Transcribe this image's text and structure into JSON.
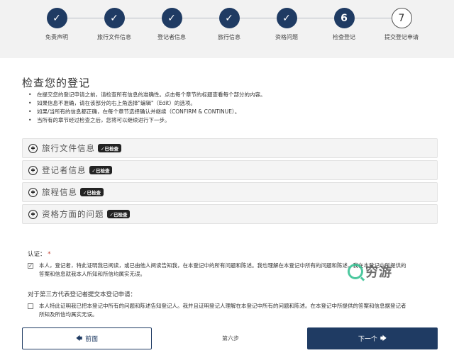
{
  "stepper": {
    "steps": [
      {
        "marker": "✓",
        "label": "免责声明",
        "state": "done"
      },
      {
        "marker": "✓",
        "label": "旅行文件信息",
        "state": "done"
      },
      {
        "marker": "✓",
        "label": "登记者信息",
        "state": "done"
      },
      {
        "marker": "✓",
        "label": "旅行信息",
        "state": "done"
      },
      {
        "marker": "✓",
        "label": "资格问题",
        "state": "done"
      },
      {
        "marker": "6",
        "label": "检查登记",
        "state": "current"
      },
      {
        "marker": "7",
        "label": "提交登记申请",
        "state": "todo"
      }
    ]
  },
  "page": {
    "title": "检查您的登记",
    "instructions": [
      "在提交您的登记申请之前，请检查所有信息的准确性。点击每个章节的标题查看每个部分的内容。",
      "如果信息不准确，请在该部分的右上角选择\"编辑\"（Edit）的选项。",
      "如果/当所有的信息都正确，在每个章节选择确认并继续（CONFIRM & CONTINUE）。",
      "当所有的章节经过检查之后，您将可以继续进行下一步。"
    ]
  },
  "sections": [
    {
      "title": "旅行文件信息",
      "badge": "✓已检查"
    },
    {
      "title": "登记者信息",
      "badge": "✓已检查"
    },
    {
      "title": "旅程信息",
      "badge": "✓已检查"
    },
    {
      "title": "资格方面的问题",
      "badge": "✓已检查"
    }
  ],
  "certification": {
    "label": "认证：",
    "required_mark": "*",
    "self_checked": "✓",
    "self_text": "本人，登记者，特此证明我已阅读，或已由他人阅读告知我，在本登记中的所有问题和陈述。我也理解在本登记中所有的问题和陈述，我在本登记中所提供的答案和信息就我本人所知和所信均属实无误。",
    "third_label": "对于第三方代表登记者提交本登记申请：",
    "third_checked": "",
    "third_text": "本人特此证明我已把本登记中所有的问题和陈述告知登记人。我并且证明登记人理解在本登记中所有的问题和陈述。在本登记中所提供的答案和信息据登记者所知及所信均属实无误。"
  },
  "footer": {
    "prev_label": "前面",
    "prev_icon": "arrow-left-icon",
    "step_text": "第六步",
    "next_label": "下一个",
    "next_icon": "arrow-right-icon"
  },
  "watermark": {
    "text": "穷游",
    "icon": "q-logo-icon"
  },
  "colors": {
    "primary": "#1f3b63",
    "stepper_bg": "#f2f2f2",
    "section_bg": "#f4f4f4",
    "badge_bg": "#222222"
  }
}
